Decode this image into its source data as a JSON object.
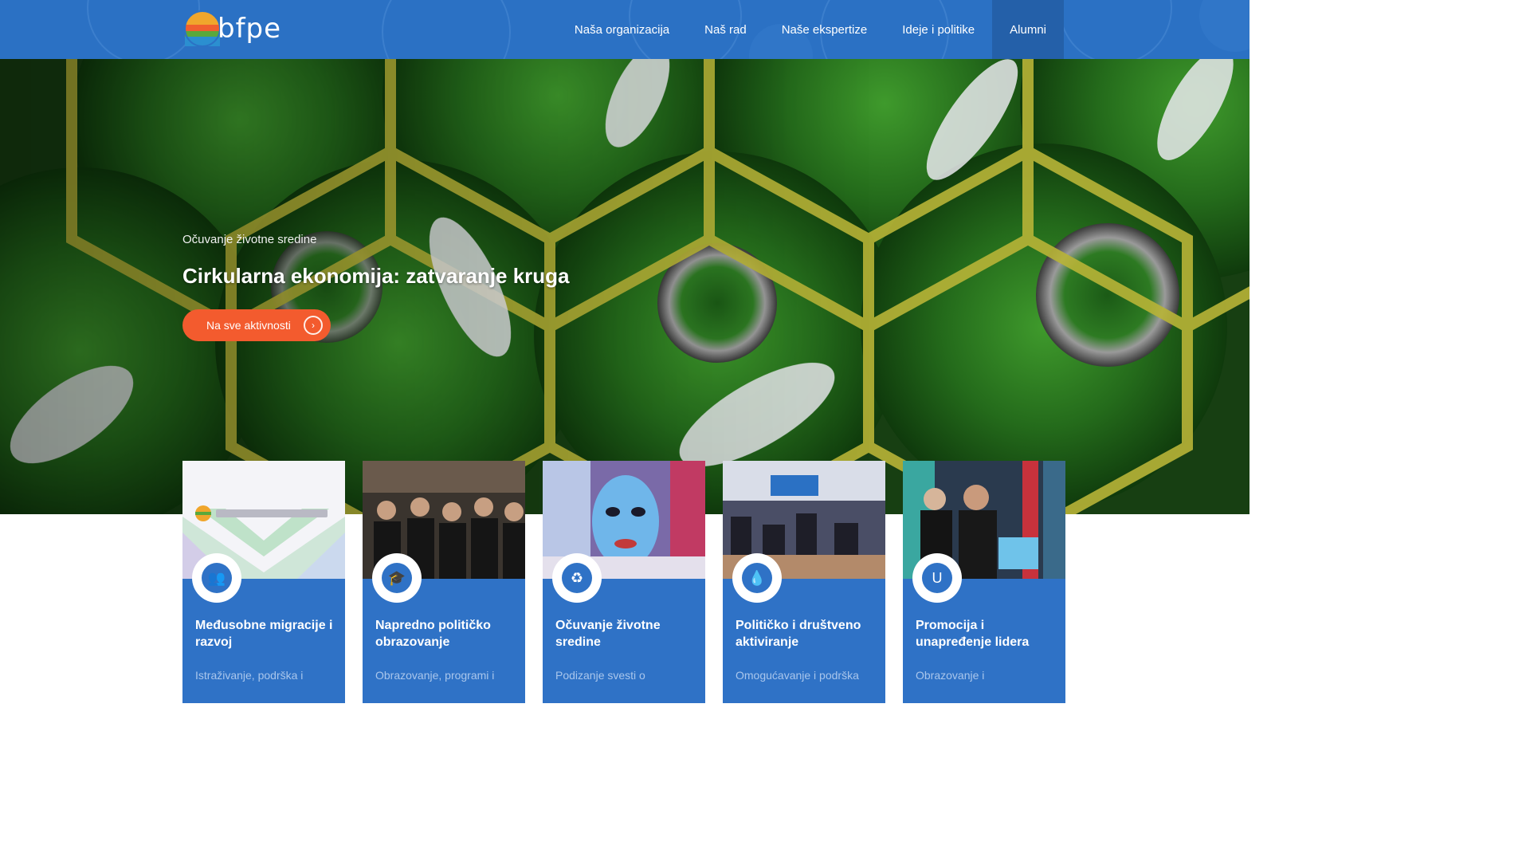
{
  "brand": {
    "logo_text": "bfpe",
    "colors": {
      "nav_blue": "#2b71c4",
      "card_blue": "#2f72c6",
      "accent_orange": "#f35b2e"
    }
  },
  "nav": {
    "items": [
      {
        "label": "Naša organizacija",
        "active": false
      },
      {
        "label": "Naš rad",
        "active": false
      },
      {
        "label": "Naše ekspertize",
        "active": false
      },
      {
        "label": "Ideje i politike",
        "active": false
      },
      {
        "label": "Alumni",
        "active": true
      }
    ]
  },
  "hero": {
    "kicker": "Očuvanje životne sredine",
    "title": "Cirkularna ekonomija: zatvaranje kruga",
    "button_label": "Na sve aktivnosti",
    "button_icon": "arrow-right-icon"
  },
  "cards": [
    {
      "title": "Međusobne migracije i razvoj",
      "desc": "Istraživanje, podrška i",
      "icon": "users-icon"
    },
    {
      "title": "Napredno političko obrazovanje",
      "desc": "Obrazovanje, programi i",
      "icon": "graduation-icon"
    },
    {
      "title": "Očuvanje životne sredine",
      "desc": "Podizanje svesti o",
      "icon": "recycle-icon"
    },
    {
      "title": "Političko i društveno aktiviranje",
      "desc": "Omogućavanje i podrška",
      "icon": "drop-icon"
    },
    {
      "title": "Promocija i unapređenje lidera",
      "desc": "Obrazovanje i",
      "icon": "magnet-icon"
    }
  ]
}
